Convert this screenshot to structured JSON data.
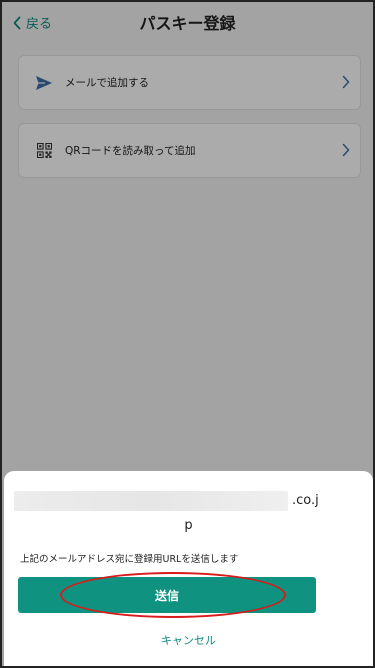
{
  "header": {
    "back_label": "戻る",
    "title": "パスキー登録"
  },
  "options": [
    {
      "label": "メールで追加する",
      "icon": "send-icon"
    },
    {
      "label": "QRコードを読み取って追加",
      "icon": "qr-code-icon"
    }
  ],
  "sheet": {
    "email_suffix": ".co.j",
    "email_wrap": "p",
    "notice": "上記のメールアドレス宛に登録用URLを送信します",
    "send_label": "送信",
    "cancel_label": "キャンセル"
  },
  "colors": {
    "accent": "#0f927f",
    "link": "#0e8a7b",
    "highlight": "#d81b1b"
  }
}
